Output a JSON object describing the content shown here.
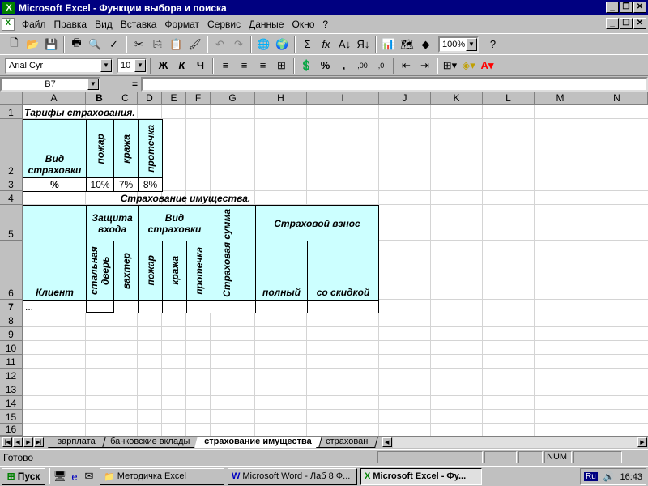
{
  "window": {
    "title": "Microsoft Excel - Функции выбора и поиска",
    "app_icon": "excel-icon"
  },
  "menu": [
    "Файл",
    "Правка",
    "Вид",
    "Вставка",
    "Формат",
    "Сервис",
    "Данные",
    "Окно",
    "?"
  ],
  "toolbar1": {
    "zoom": "100%"
  },
  "toolbar2": {
    "font": "Arial Cyr",
    "size": "10",
    "bold": "Ж",
    "italic": "К",
    "underline": "Ч",
    "percent": "%",
    "comma": ",",
    "inc_dec": ",00",
    "dec_dec": ",0"
  },
  "formula_bar": {
    "name_box": "B7",
    "equals": "=",
    "content": ""
  },
  "columns": [
    "A",
    "B",
    "C",
    "D",
    "E",
    "F",
    "G",
    "H",
    "I",
    "J",
    "K",
    "L",
    "M",
    "N"
  ],
  "rows": [
    "1",
    "2",
    "3",
    "4",
    "5",
    "6",
    "7",
    "8",
    "9",
    "10",
    "11",
    "12",
    "13",
    "14",
    "15",
    "16"
  ],
  "cells": {
    "a1": "Тарифы страхования.",
    "a2": "Вид страховки",
    "b2": "пожар",
    "c2": "кража",
    "d2": "протечка",
    "a3": "%",
    "b3": "10%",
    "c3": "7%",
    "d3": "8%",
    "b4": "Страхование имущества.",
    "b5": "Защита входа",
    "d5": "Вид страховки",
    "h5": "Страховой взнос",
    "a6": "Клиент",
    "b6": "стальная дверь",
    "c6": "вахтер",
    "d6": "пожар",
    "e6": "кража",
    "f6": "протечка",
    "g5": "Страховая сумма",
    "h6": "полный",
    "i6": "со скидкой",
    "a7": "..."
  },
  "sheet_tabs": [
    "зарплата",
    "банковские вклады",
    "страхование имущества",
    "страхован"
  ],
  "active_tab": "страхование имущества",
  "status": {
    "text": "Готово",
    "num": "NUM"
  },
  "taskbar": {
    "start": "Пуск",
    "tasks": [
      "Методичка Excel",
      "Microsoft Word - Лаб 8 Ф...",
      "Microsoft Excel - Фу..."
    ],
    "lang": "Ru",
    "time": "16:43"
  }
}
